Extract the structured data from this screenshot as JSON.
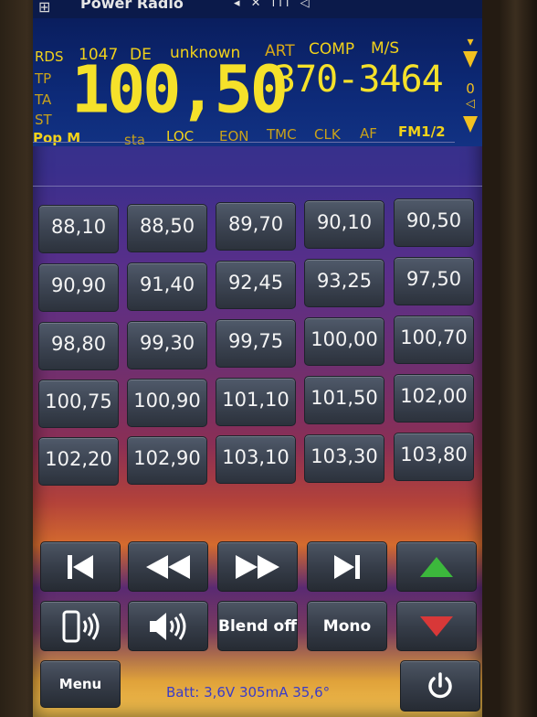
{
  "titlebar": {
    "title": "Power Radio",
    "status_icons": "◂ ✕  ıll ◁"
  },
  "lcd": {
    "rds": "RDS",
    "pi": "1047",
    "country": "DE",
    "station": "unknown",
    "art": "ART",
    "comp": "COMP",
    "ms": "M/S",
    "tp": "TP",
    "ta": "TA",
    "st": "ST",
    "frequency": "100,50",
    "phone_number": "370-3464",
    "signal_value": "0",
    "pty": "Pop M",
    "sta": "sta",
    "loc": "LOC",
    "eon": "EON",
    "tmc": "TMC",
    "clk": "CLK",
    "af": "AF",
    "band": "FM1/2"
  },
  "presets": [
    [
      "88,10",
      "88,50",
      "89,70",
      "90,10",
      "90,50"
    ],
    [
      "90,90",
      "91,40",
      "92,45",
      "93,25",
      "97,50"
    ],
    [
      "98,80",
      "99,30",
      "99,75",
      "100,00",
      "100,70"
    ],
    [
      "100,75",
      "100,90",
      "101,10",
      "101,50",
      "102,00"
    ],
    [
      "102,20",
      "102,90",
      "103,10",
      "103,30",
      "103,80"
    ]
  ],
  "controls": {
    "blend": "Blend off",
    "mono": "Mono",
    "menu": "Menu"
  },
  "status": {
    "battery": "Batt: 3,6V  305mA  35,6°"
  },
  "colors": {
    "lcd_text": "#f2d21a",
    "up_arrow": "#3cb83c",
    "down_arrow": "#d83838"
  }
}
